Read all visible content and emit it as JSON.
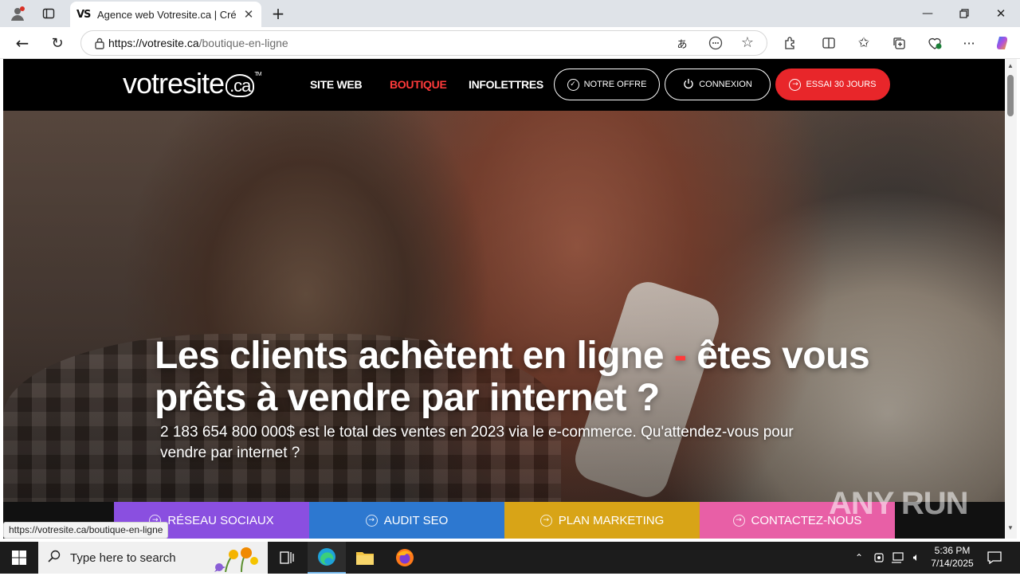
{
  "browser": {
    "tab_title": "Agence web Votresite.ca | Créer m",
    "tab_favicon": "VS",
    "url_host": "https://votresite.ca",
    "url_path": "/boutique-en-ligne",
    "status_url": "https://votresite.ca/boutique-en-ligne"
  },
  "site": {
    "logo_main": "votresite",
    "logo_ca": ".ca",
    "logo_tm": "TM",
    "nav": {
      "site_web": "SITE WEB",
      "boutique": "BOUTIQUE",
      "infolettres": "INFOLETTRES"
    },
    "buttons": {
      "notre_offre": "NOTRE OFFRE",
      "connexion": "CONNEXION",
      "essai": "ESSAI 30 JOURS"
    },
    "hero": {
      "headline_part1": "Les clients achètent en ligne ",
      "headline_dash": "-",
      "headline_part2": " êtes vous prêts à vendre par internet ?",
      "subline": "2 183 654 800 000$ est le total des ventes en 2023 via le e-commerce. Qu'attendez-vous pour vendre par internet ?"
    },
    "cta": {
      "reseau": "RÉSEAU SOCIAUX",
      "audit": "AUDIT SEO",
      "plan": "PLAN MARKETING",
      "contact": "CONTACTEZ-NOUS"
    },
    "colors": {
      "accent_red": "#e8262a",
      "reseau": "#8a4fe0",
      "audit": "#2d78d0",
      "plan": "#d8a417",
      "contact": "#e85fa6"
    }
  },
  "watermark": {
    "text": "ANY RUN"
  },
  "taskbar": {
    "search_placeholder": "Type here to search",
    "time": "5:36 PM",
    "date": "7/14/2025"
  }
}
